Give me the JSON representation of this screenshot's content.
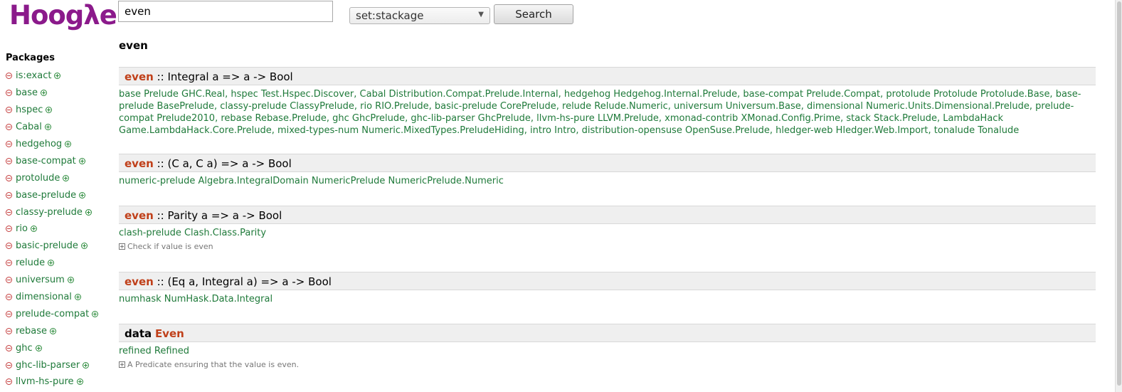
{
  "header": {
    "logo_text": "Hoogλe",
    "search_value": "even",
    "scope_value": "set:stackage",
    "search_button": "Search"
  },
  "sidebar": {
    "title": "Packages",
    "items": [
      "is:exact",
      "base",
      "hspec",
      "Cabal",
      "hedgehog",
      "base-compat",
      "protolude",
      "base-prelude",
      "classy-prelude",
      "rio",
      "basic-prelude",
      "relude",
      "universum",
      "dimensional",
      "prelude-compat",
      "rebase",
      "ghc",
      "ghc-lib-parser",
      "llvm-hs-pure"
    ]
  },
  "main": {
    "query_heading": "even",
    "results": [
      {
        "name": "even",
        "signature": ":: Integral a => a -> Bool",
        "packages": "base Prelude GHC.Real, hspec Test.Hspec.Discover, Cabal Distribution.Compat.Prelude.Internal, hedgehog Hedgehog.Internal.Prelude, base-compat Prelude.Compat, protolude Protolude Protolude.Base, base-prelude BasePrelude, classy-prelude ClassyPrelude, rio RIO.Prelude, basic-prelude CorePrelude, relude Relude.Numeric, universum Universum.Base, dimensional Numeric.Units.Dimensional.Prelude, prelude-compat Prelude2010, rebase Rebase.Prelude, ghc GhcPrelude, ghc-lib-parser GhcPrelude, llvm-hs-pure LLVM.Prelude, xmonad-contrib XMonad.Config.Prime, stack Stack.Prelude, LambdaHack Game.LambdaHack.Core.Prelude, mixed-types-num Numeric.MixedTypes.PreludeHiding, intro Intro, distribution-opensuse OpenSuse.Prelude, hledger-web Hledger.Web.Import, tonalude Tonalude"
      },
      {
        "name": "even",
        "signature": ":: (C a, C a) => a -> Bool",
        "packages": "numeric-prelude Algebra.IntegralDomain NumericPrelude NumericPrelude.Numeric"
      },
      {
        "name": "even",
        "signature": ":: Parity a => a -> Bool",
        "packages": "clash-prelude Clash.Class.Parity",
        "doc": "Check if value is even"
      },
      {
        "name": "even",
        "signature": ":: (Eq a, Integral a) => a -> Bool",
        "packages": "numhask NumHask.Data.Integral"
      },
      {
        "keyword": "data",
        "name": "Even",
        "packages": "refined Refined",
        "doc": "A Predicate ensuring that the value is even."
      }
    ]
  }
}
